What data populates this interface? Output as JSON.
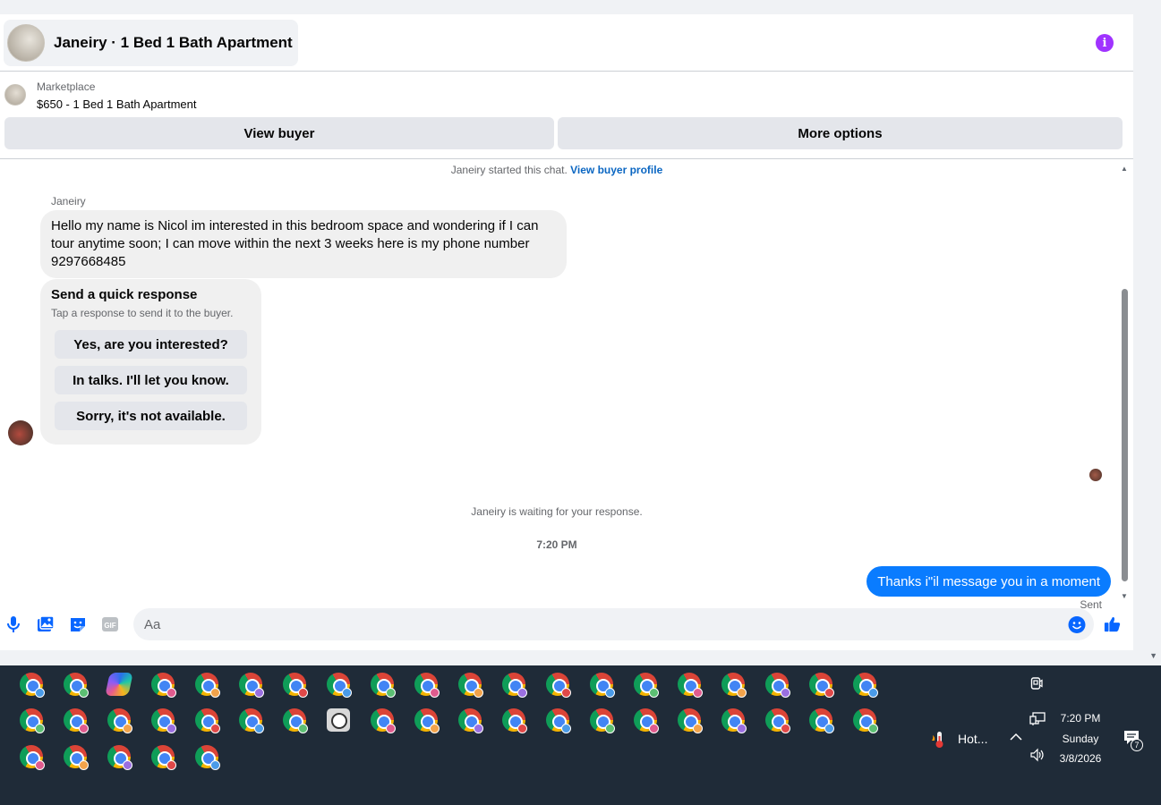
{
  "header": {
    "title": "Janeiry · 1 Bed 1 Bath Apartment"
  },
  "listing": {
    "source_label": "Marketplace",
    "summary": "$650 - 1 Bed 1 Bath Apartment"
  },
  "actions": {
    "view_buyer": "View buyer",
    "more_options": "More options"
  },
  "conversation": {
    "started_text": "Janeiry started this chat.",
    "view_profile_link": "View buyer profile",
    "sender_name": "Janeiry",
    "incoming_message": "Hello my name is Nicol im interested in this bedroom space  and wondering  if I can tour anytime soon; I can move within the next 3 weeks here is  my phone number 9297668485",
    "quick_response": {
      "title": "Send a quick response",
      "subtitle": "Tap a response to send it to the buyer.",
      "options": [
        "Yes, are you interested?",
        "In talks. I'll let you know.",
        "Sorry, it's not available."
      ]
    },
    "waiting_text": "Janeiry is waiting for your response.",
    "timestamp": "7:20 PM",
    "outgoing_message": "Thanks i\"il message you in a moment",
    "status": "Sent"
  },
  "composer": {
    "placeholder": "Aa",
    "icons": [
      "microphone-icon",
      "photo-icon",
      "sticker-icon",
      "gif-icon",
      "emoji-icon",
      "thumbs-up-icon"
    ],
    "gif_label": "GIF"
  },
  "taskbar": {
    "weather_text": "Hot...",
    "time": "7:20 PM",
    "day": "Sunday",
    "date": "3/8/2026",
    "notification_count": "7",
    "profile_badge_colors": [
      "#4a9be8",
      "#5cbf73",
      "#e05b8e",
      "#f2a34b",
      "#9a6fe0",
      "#e04848"
    ]
  },
  "colors": {
    "accent_blue": "#0a7cff",
    "link_blue": "#0a66c2",
    "info_purple": "#a033ff",
    "taskbar_bg": "#1f2b38"
  }
}
